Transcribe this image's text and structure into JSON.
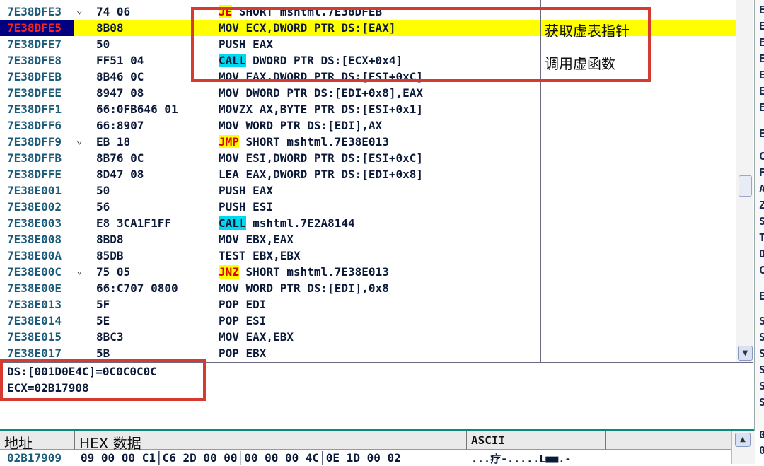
{
  "disassembly": {
    "rows": [
      {
        "addr": "7E38DFE3",
        "mark": "⌄",
        "hex": "74 06",
        "op": "JE",
        "rest": " SHORT mshtml.7E38DFEB",
        "opstyle": "jmp",
        "cmt": ""
      },
      {
        "addr": "7E38DFE5",
        "mark": "",
        "hex": "8B08",
        "op": "",
        "rest": "MOV ECX,DWORD PTR DS:[EAX]",
        "opstyle": "",
        "cmt": "获取虚表指针",
        "selected": true
      },
      {
        "addr": "7E38DFE7",
        "mark": "",
        "hex": "50",
        "op": "",
        "rest": "PUSH EAX",
        "opstyle": "",
        "cmt": ""
      },
      {
        "addr": "7E38DFE8",
        "mark": "",
        "hex": "FF51 04",
        "op": "CALL",
        "rest": " DWORD PTR DS:[ECX+0x4]",
        "opstyle": "call",
        "cmt": "调用虚函数"
      },
      {
        "addr": "7E38DFEB",
        "mark": "",
        "hex": "8B46 0C",
        "op": "",
        "rest": "MOV EAX,DWORD PTR DS:[ESI+0xC]",
        "opstyle": "",
        "cmt": ""
      },
      {
        "addr": "7E38DFEE",
        "mark": "",
        "hex": "8947 08",
        "op": "",
        "rest": "MOV DWORD PTR DS:[EDI+0x8],EAX",
        "opstyle": "",
        "cmt": ""
      },
      {
        "addr": "7E38DFF1",
        "mark": "",
        "hex": "66:0FB646 01",
        "op": "",
        "rest": "MOVZX AX,BYTE PTR DS:[ESI+0x1]",
        "opstyle": "",
        "cmt": ""
      },
      {
        "addr": "7E38DFF6",
        "mark": "",
        "hex": "66:8907",
        "op": "",
        "rest": "MOV WORD PTR DS:[EDI],AX",
        "opstyle": "",
        "cmt": ""
      },
      {
        "addr": "7E38DFF9",
        "mark": "⌄",
        "hex": "EB 18",
        "op": "JMP",
        "rest": " SHORT mshtml.7E38E013",
        "opstyle": "jmp",
        "cmt": ""
      },
      {
        "addr": "7E38DFFB",
        "mark": "",
        "hex": "8B76 0C",
        "op": "",
        "rest": "MOV ESI,DWORD PTR DS:[ESI+0xC]",
        "opstyle": "",
        "cmt": ""
      },
      {
        "addr": "7E38DFFE",
        "mark": "",
        "hex": "8D47 08",
        "op": "",
        "rest": "LEA EAX,DWORD PTR DS:[EDI+0x8]",
        "opstyle": "",
        "cmt": ""
      },
      {
        "addr": "7E38E001",
        "mark": "",
        "hex": "50",
        "op": "",
        "rest": "PUSH EAX",
        "opstyle": "",
        "cmt": ""
      },
      {
        "addr": "7E38E002",
        "mark": "",
        "hex": "56",
        "op": "",
        "rest": "PUSH ESI",
        "opstyle": "",
        "cmt": ""
      },
      {
        "addr": "7E38E003",
        "mark": "",
        "hex": "E8 3CA1F1FF",
        "op": "CALL",
        "rest": " mshtml.7E2A8144",
        "opstyle": "call",
        "cmt": ""
      },
      {
        "addr": "7E38E008",
        "mark": "",
        "hex": "8BD8",
        "op": "",
        "rest": "MOV EBX,EAX",
        "opstyle": "",
        "cmt": ""
      },
      {
        "addr": "7E38E00A",
        "mark": "",
        "hex": "85DB",
        "op": "",
        "rest": "TEST EBX,EBX",
        "opstyle": "",
        "cmt": ""
      },
      {
        "addr": "7E38E00C",
        "mark": "⌄",
        "hex": "75 05",
        "op": "JNZ",
        "rest": " SHORT mshtml.7E38E013",
        "opstyle": "jmp",
        "cmt": ""
      },
      {
        "addr": "7E38E00E",
        "mark": "",
        "hex": "66:C707 0800",
        "op": "",
        "rest": "MOV WORD PTR DS:[EDI],0x8",
        "opstyle": "",
        "cmt": ""
      },
      {
        "addr": "7E38E013",
        "mark": "",
        "hex": "5F",
        "op": "",
        "rest": "POP EDI",
        "opstyle": "",
        "cmt": ""
      },
      {
        "addr": "7E38E014",
        "mark": "",
        "hex": "5E",
        "op": "",
        "rest": "POP ESI",
        "opstyle": "",
        "cmt": ""
      },
      {
        "addr": "7E38E015",
        "mark": "",
        "hex": "8BC3",
        "op": "",
        "rest": "MOV EAX,EBX",
        "opstyle": "",
        "cmt": ""
      },
      {
        "addr": "7E38E017",
        "mark": "",
        "hex": "5B",
        "op": "",
        "rest": "POP EBX",
        "opstyle": "",
        "cmt": ""
      }
    ]
  },
  "info": {
    "line1": "DS:[001D0E4C]=0C0C0C0C",
    "line2": "ECX=02B17908"
  },
  "dump": {
    "col_address": "地址",
    "col_hex": "HEX 数据",
    "col_ascii": "ASCII",
    "row_addr": "02B17909",
    "row_hex": "09 00 00 C1│C6 2D 00 00│00 00 00 4C│0E 1D 00 02",
    "row_ascii": "...疗-.....L■■.-"
  },
  "register_strip": [
    "E",
    "E",
    "E",
    "E",
    "E",
    "E",
    "E",
    "E",
    "C",
    "F",
    "A",
    "Z",
    "S",
    "T",
    "D",
    "C",
    "E",
    "S",
    "S",
    "S",
    "S",
    "S",
    "S",
    "0",
    "0"
  ],
  "colors": {
    "selected_row": "#ffff00",
    "call_highlight": "#00d8f0",
    "jump_text": "#e00000",
    "annotation_box": "#d63a30"
  }
}
